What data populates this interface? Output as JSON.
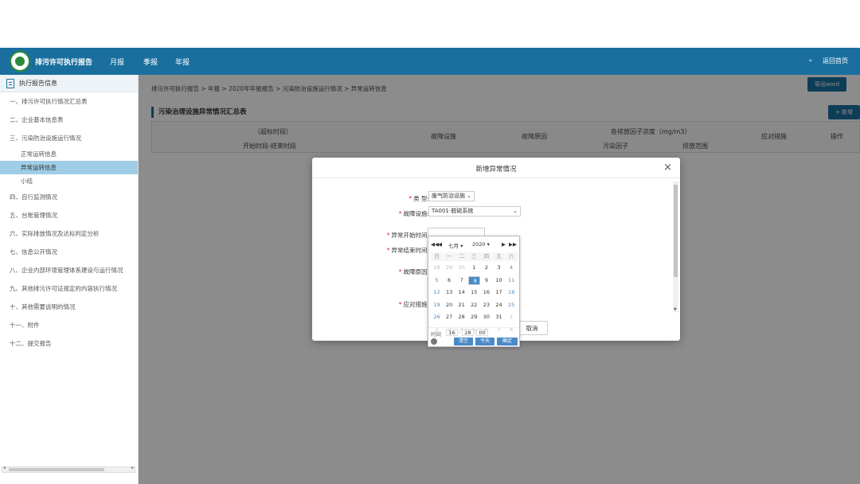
{
  "header": {
    "app_title": "排污许可执行报告",
    "nav": [
      "月报",
      "季报",
      "年报"
    ],
    "home_label": "返回首页",
    "chevron": "⌄"
  },
  "sidebar": {
    "top_label": "执行报告信息",
    "items": [
      "一、排污许可执行情况汇总表",
      "二、企业基本信息表",
      "三、污染防治设施运行情况"
    ],
    "sub_items": [
      "正常运转信息",
      "异常运转信息",
      "小结"
    ],
    "active_sub": 1,
    "items_after": [
      "四、自行监测情况",
      "五、台账管理情况",
      "六、实际排放情况及达标判定分析",
      "七、信息公开情况",
      "八、企业内部环境管理体系建设与运行情况",
      "九、其他排污许可证规定的内容执行情况",
      "十、其他需要说明的情况",
      "十一、附件",
      "十二、提交报告"
    ]
  },
  "main": {
    "breadcrumb": "排污许可执行报告 > 年报 > 2020年年报报告 > 污染防治设施运行情况 > 异常运转信息",
    "export_word_label": "导出word",
    "section_title": "污染治理设施异常情况汇总表",
    "add_label": "+ 新增",
    "table_headers": {
      "time_group": "（超标时段）",
      "time_sub": "开始时段-结束时段",
      "facility": "故障设施",
      "reason": "故障原因",
      "concentration": "各排放因子浓度（mg/m3）",
      "factor": "污染因子",
      "range": "排放范围",
      "measures": "应对措施",
      "ops": "操作"
    }
  },
  "dialog": {
    "title": "新增异常情况",
    "close": "×",
    "fields": {
      "type_label": "类   型:",
      "type_value": "废气防治设施",
      "facility_label": "故障设施:",
      "facility_value": "TA001-脱硫系统",
      "start_label": "异常开始时间:",
      "end_label": "异常结束时间:",
      "reason_label": "故障原因:",
      "measures_label": "应对措施:"
    },
    "cancel_label": "取消"
  },
  "datepicker": {
    "month": "七月",
    "year": "2020",
    "prev_year": "◀◀",
    "prev_month": "◀",
    "next_month": "▶",
    "next_year": "▶▶",
    "weekdays": [
      "日",
      "一",
      "二",
      "三",
      "四",
      "五",
      "六"
    ],
    "days": [
      [
        "28",
        "29",
        "30",
        "1",
        "2",
        "3",
        "4"
      ],
      [
        "5",
        "6",
        "7",
        "8",
        "9",
        "10",
        "11"
      ],
      [
        "12",
        "13",
        "14",
        "15",
        "16",
        "17",
        "18"
      ],
      [
        "19",
        "20",
        "21",
        "22",
        "23",
        "24",
        "25"
      ],
      [
        "26",
        "27",
        "28",
        "29",
        "30",
        "31",
        "1"
      ],
      [
        "2",
        "3",
        "4",
        "5",
        "6",
        "7",
        "8"
      ]
    ],
    "selected_day": "8",
    "time_label": "时间",
    "hour": "16",
    "minute": "28",
    "second": "00",
    "btn_clear": "清空",
    "btn_today": "今天",
    "btn_ok": "确定"
  }
}
